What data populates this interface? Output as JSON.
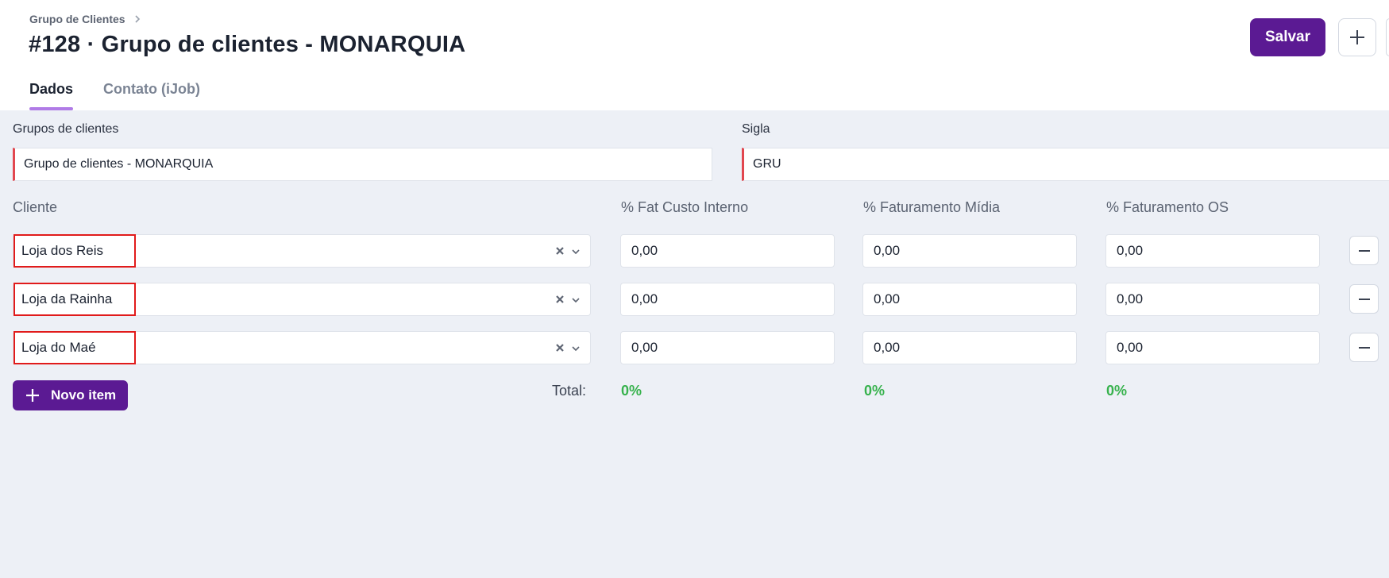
{
  "header": {
    "breadcrumb": "Grupo de Clientes",
    "title": "#128 · Grupo de clientes - MONARQUIA",
    "save_label": "Salvar",
    "tabs": [
      {
        "label": "Dados",
        "active": true
      },
      {
        "label": "Contato (iJob)",
        "active": false
      }
    ]
  },
  "form": {
    "group_label": "Grupos de clientes",
    "group_value": "Grupo de clientes - MONARQUIA",
    "sigla_label": "Sigla",
    "sigla_value": "GRU"
  },
  "table": {
    "columns": [
      "Cliente",
      "% Fat Custo Interno",
      "% Faturamento Mídia",
      "% Faturamento OS"
    ],
    "rows": [
      {
        "cliente": "Loja dos Reis",
        "custo_interno": "0,00",
        "midia": "0,00",
        "os": "0,00"
      },
      {
        "cliente": "Loja da Rainha",
        "custo_interno": "0,00",
        "midia": "0,00",
        "os": "0,00"
      },
      {
        "cliente": "Loja do Maé",
        "custo_interno": "0,00",
        "midia": "0,00",
        "os": "0,00"
      }
    ],
    "new_item_label": "Novo item",
    "total_label": "Total:",
    "totals": {
      "custo_interno": "0%",
      "midia": "0%",
      "os": "0%"
    }
  },
  "colors": {
    "accent": "#5b1a93",
    "tab_underline": "#b07be6",
    "required_border": "#e2474f",
    "highlight_box": "#e11b1b",
    "total_green": "#37b24d",
    "background": "#edf0f6"
  },
  "icons": {
    "breadcrumb_separator": "chevron-right-icon",
    "add": "plus-icon",
    "clear": "close-icon",
    "dropdown": "chevron-down-icon",
    "remove": "minus-icon"
  }
}
